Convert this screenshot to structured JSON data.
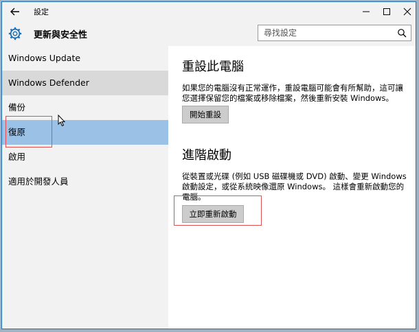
{
  "window": {
    "app_title": "設定"
  },
  "header": {
    "section_title": "更新與安全性",
    "search_placeholder": "尋找設定"
  },
  "sidebar": {
    "items": [
      {
        "label": "Windows Update"
      },
      {
        "label": "Windows Defender"
      },
      {
        "label": "備份"
      },
      {
        "label": "復原"
      },
      {
        "label": "啟用"
      },
      {
        "label": "適用於開發人員"
      }
    ]
  },
  "main": {
    "reset": {
      "title": "重設此電腦",
      "description": "如果您的電腦沒有正常運作，重設電腦可能會有所幫助，這可讓您選擇保留您的檔案或移除檔案，然後重新安裝 Windows。",
      "button_label": "開始重設"
    },
    "advanced": {
      "title": "進階啟動",
      "description": "從裝置或光碟 (例如 USB 磁碟機或 DVD) 啟動、變更 Windows 啟動設定，或從系統映像還原 Windows。 這樣會重新啟動您的電腦。",
      "button_label": "立即重新啟動"
    }
  },
  "colors": {
    "selected_nav": "#9bc1e6",
    "annotation": "#e05050"
  }
}
